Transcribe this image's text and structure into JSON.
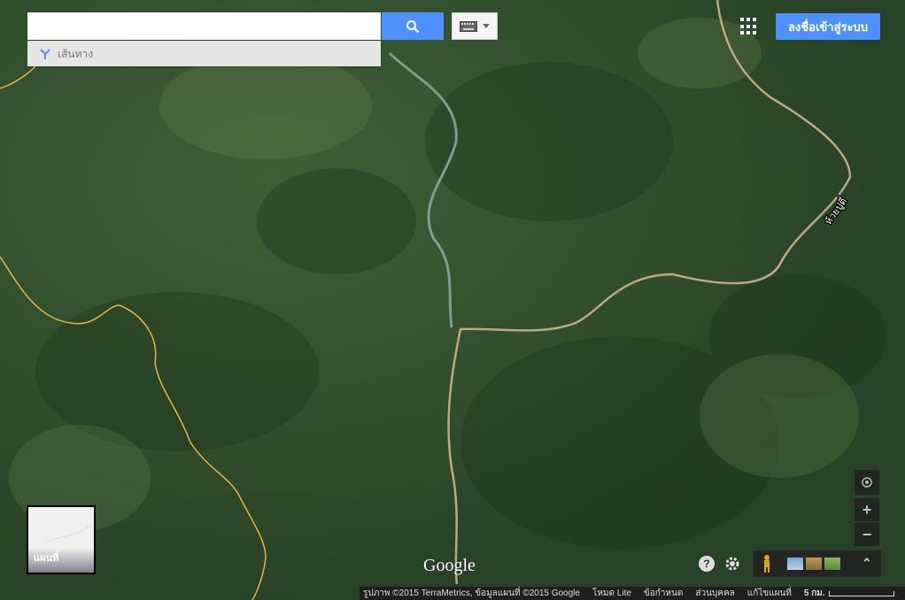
{
  "search": {
    "placeholder": "",
    "value": ""
  },
  "directions": {
    "label": "เส้นทาง"
  },
  "header": {
    "signin_label": "ลงชื่อเข้าสู่ระบบ"
  },
  "map": {
    "type": "satellite",
    "place_label": "ห้วยปูตี่",
    "logo": "Google"
  },
  "minimap": {
    "label": "แผนที่"
  },
  "footer": {
    "attribution": "รูปภาพ ©2015 TerraMetrics, ข้อมูลแผนที่ ©2015 Google",
    "lite_mode": "โหมด Lite",
    "terms": "ข้อกำหนด",
    "privacy": "ส่วนบุคคล",
    "report": "แก้ไขแผนที่",
    "scale": "5 กม."
  },
  "colors": {
    "accent": "#4d90fe",
    "border_line": "#e3b443",
    "road": "#c9b48e"
  }
}
